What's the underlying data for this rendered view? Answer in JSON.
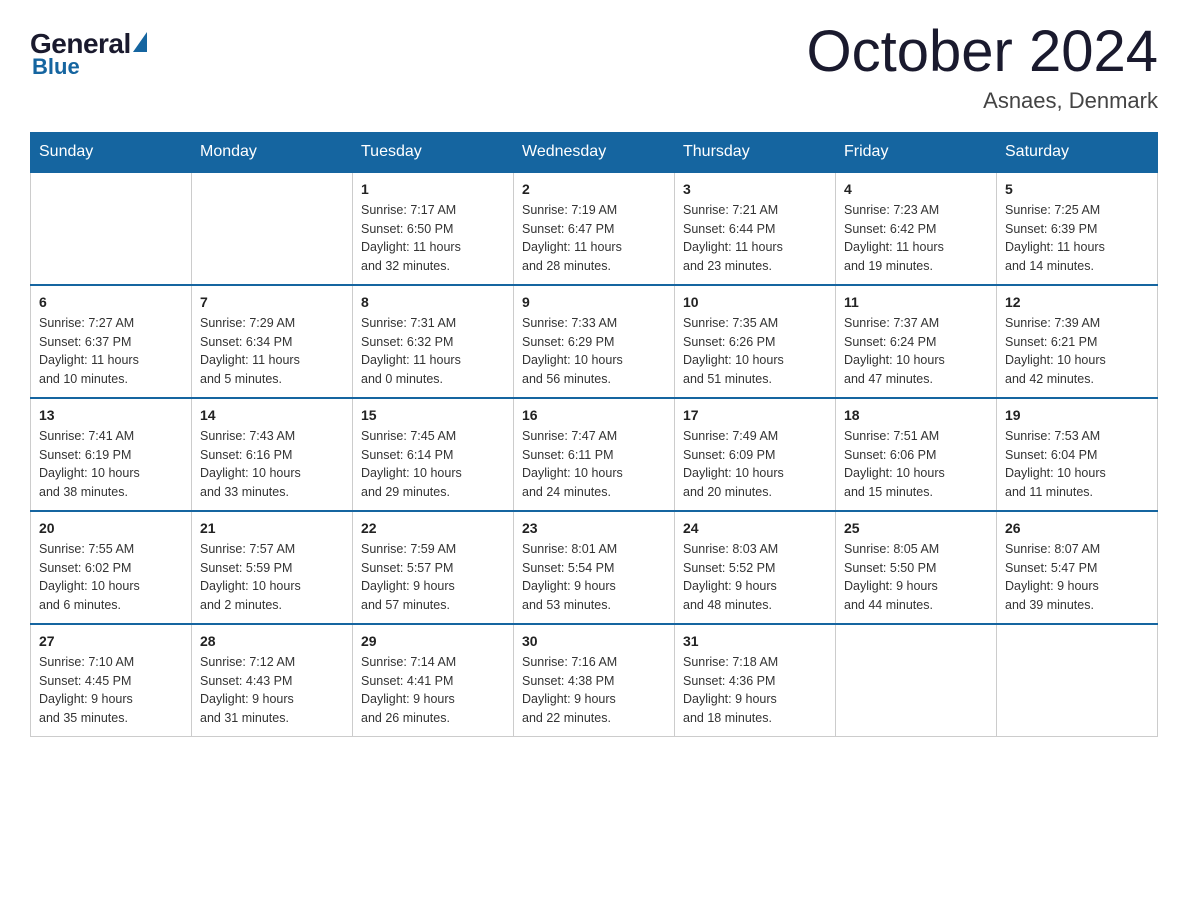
{
  "header": {
    "logo": {
      "general": "General",
      "blue": "Blue"
    },
    "title": "October 2024",
    "location": "Asnaes, Denmark"
  },
  "weekdays": [
    "Sunday",
    "Monday",
    "Tuesday",
    "Wednesday",
    "Thursday",
    "Friday",
    "Saturday"
  ],
  "weeks": [
    [
      {
        "day": "",
        "info": ""
      },
      {
        "day": "",
        "info": ""
      },
      {
        "day": "1",
        "info": "Sunrise: 7:17 AM\nSunset: 6:50 PM\nDaylight: 11 hours\nand 32 minutes."
      },
      {
        "day": "2",
        "info": "Sunrise: 7:19 AM\nSunset: 6:47 PM\nDaylight: 11 hours\nand 28 minutes."
      },
      {
        "day": "3",
        "info": "Sunrise: 7:21 AM\nSunset: 6:44 PM\nDaylight: 11 hours\nand 23 minutes."
      },
      {
        "day": "4",
        "info": "Sunrise: 7:23 AM\nSunset: 6:42 PM\nDaylight: 11 hours\nand 19 minutes."
      },
      {
        "day": "5",
        "info": "Sunrise: 7:25 AM\nSunset: 6:39 PM\nDaylight: 11 hours\nand 14 minutes."
      }
    ],
    [
      {
        "day": "6",
        "info": "Sunrise: 7:27 AM\nSunset: 6:37 PM\nDaylight: 11 hours\nand 10 minutes."
      },
      {
        "day": "7",
        "info": "Sunrise: 7:29 AM\nSunset: 6:34 PM\nDaylight: 11 hours\nand 5 minutes."
      },
      {
        "day": "8",
        "info": "Sunrise: 7:31 AM\nSunset: 6:32 PM\nDaylight: 11 hours\nand 0 minutes."
      },
      {
        "day": "9",
        "info": "Sunrise: 7:33 AM\nSunset: 6:29 PM\nDaylight: 10 hours\nand 56 minutes."
      },
      {
        "day": "10",
        "info": "Sunrise: 7:35 AM\nSunset: 6:26 PM\nDaylight: 10 hours\nand 51 minutes."
      },
      {
        "day": "11",
        "info": "Sunrise: 7:37 AM\nSunset: 6:24 PM\nDaylight: 10 hours\nand 47 minutes."
      },
      {
        "day": "12",
        "info": "Sunrise: 7:39 AM\nSunset: 6:21 PM\nDaylight: 10 hours\nand 42 minutes."
      }
    ],
    [
      {
        "day": "13",
        "info": "Sunrise: 7:41 AM\nSunset: 6:19 PM\nDaylight: 10 hours\nand 38 minutes."
      },
      {
        "day": "14",
        "info": "Sunrise: 7:43 AM\nSunset: 6:16 PM\nDaylight: 10 hours\nand 33 minutes."
      },
      {
        "day": "15",
        "info": "Sunrise: 7:45 AM\nSunset: 6:14 PM\nDaylight: 10 hours\nand 29 minutes."
      },
      {
        "day": "16",
        "info": "Sunrise: 7:47 AM\nSunset: 6:11 PM\nDaylight: 10 hours\nand 24 minutes."
      },
      {
        "day": "17",
        "info": "Sunrise: 7:49 AM\nSunset: 6:09 PM\nDaylight: 10 hours\nand 20 minutes."
      },
      {
        "day": "18",
        "info": "Sunrise: 7:51 AM\nSunset: 6:06 PM\nDaylight: 10 hours\nand 15 minutes."
      },
      {
        "day": "19",
        "info": "Sunrise: 7:53 AM\nSunset: 6:04 PM\nDaylight: 10 hours\nand 11 minutes."
      }
    ],
    [
      {
        "day": "20",
        "info": "Sunrise: 7:55 AM\nSunset: 6:02 PM\nDaylight: 10 hours\nand 6 minutes."
      },
      {
        "day": "21",
        "info": "Sunrise: 7:57 AM\nSunset: 5:59 PM\nDaylight: 10 hours\nand 2 minutes."
      },
      {
        "day": "22",
        "info": "Sunrise: 7:59 AM\nSunset: 5:57 PM\nDaylight: 9 hours\nand 57 minutes."
      },
      {
        "day": "23",
        "info": "Sunrise: 8:01 AM\nSunset: 5:54 PM\nDaylight: 9 hours\nand 53 minutes."
      },
      {
        "day": "24",
        "info": "Sunrise: 8:03 AM\nSunset: 5:52 PM\nDaylight: 9 hours\nand 48 minutes."
      },
      {
        "day": "25",
        "info": "Sunrise: 8:05 AM\nSunset: 5:50 PM\nDaylight: 9 hours\nand 44 minutes."
      },
      {
        "day": "26",
        "info": "Sunrise: 8:07 AM\nSunset: 5:47 PM\nDaylight: 9 hours\nand 39 minutes."
      }
    ],
    [
      {
        "day": "27",
        "info": "Sunrise: 7:10 AM\nSunset: 4:45 PM\nDaylight: 9 hours\nand 35 minutes."
      },
      {
        "day": "28",
        "info": "Sunrise: 7:12 AM\nSunset: 4:43 PM\nDaylight: 9 hours\nand 31 minutes."
      },
      {
        "day": "29",
        "info": "Sunrise: 7:14 AM\nSunset: 4:41 PM\nDaylight: 9 hours\nand 26 minutes."
      },
      {
        "day": "30",
        "info": "Sunrise: 7:16 AM\nSunset: 4:38 PM\nDaylight: 9 hours\nand 22 minutes."
      },
      {
        "day": "31",
        "info": "Sunrise: 7:18 AM\nSunset: 4:36 PM\nDaylight: 9 hours\nand 18 minutes."
      },
      {
        "day": "",
        "info": ""
      },
      {
        "day": "",
        "info": ""
      }
    ]
  ]
}
